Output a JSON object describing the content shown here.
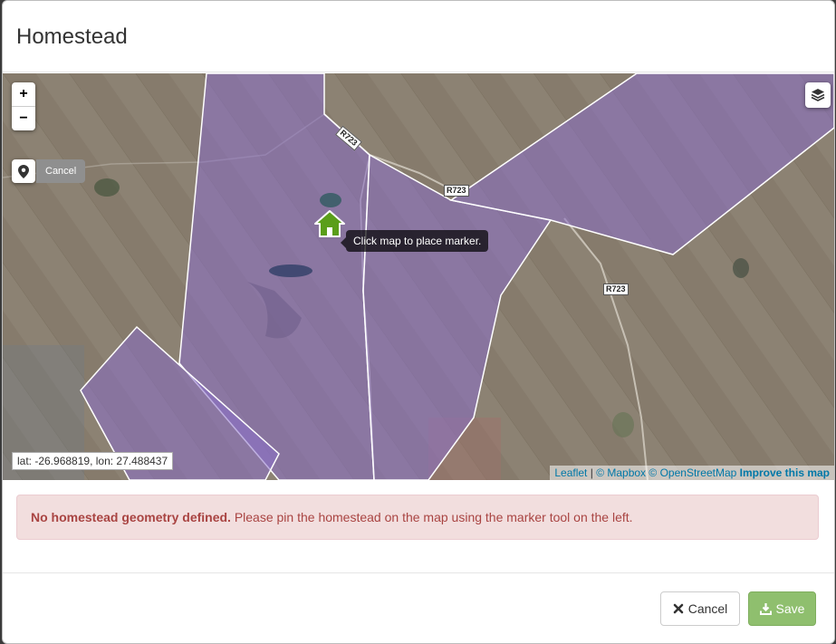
{
  "modal": {
    "title": "Homestead"
  },
  "map": {
    "zoom_in": "+",
    "zoom_out": "−",
    "marker_tool_cancel": "Cancel",
    "tooltip": "Click map to place marker.",
    "road_labels": [
      "R723",
      "R723",
      "R723"
    ],
    "coordinates": "lat: -26.968819, lon: 27.488437",
    "attribution": {
      "leaflet": "Leaflet",
      "separator": "|",
      "mapbox": "© Mapbox",
      "osm": "© OpenStreetMap",
      "improve": "Improve this map"
    },
    "icons": {
      "zoom_in": "plus-icon",
      "zoom_out": "minus-icon",
      "marker": "map-marker-icon",
      "layers": "layers-icon",
      "homestead": "house-icon"
    },
    "colors": {
      "parcel_fill": "#8a6fc8",
      "homestead_icon": "#5a9e1a"
    }
  },
  "alert": {
    "bold": "No homestead geometry defined.",
    "text": " Please pin the homestead on the map using the marker tool on the left."
  },
  "footer": {
    "cancel_label": "Cancel",
    "save_label": "Save"
  }
}
